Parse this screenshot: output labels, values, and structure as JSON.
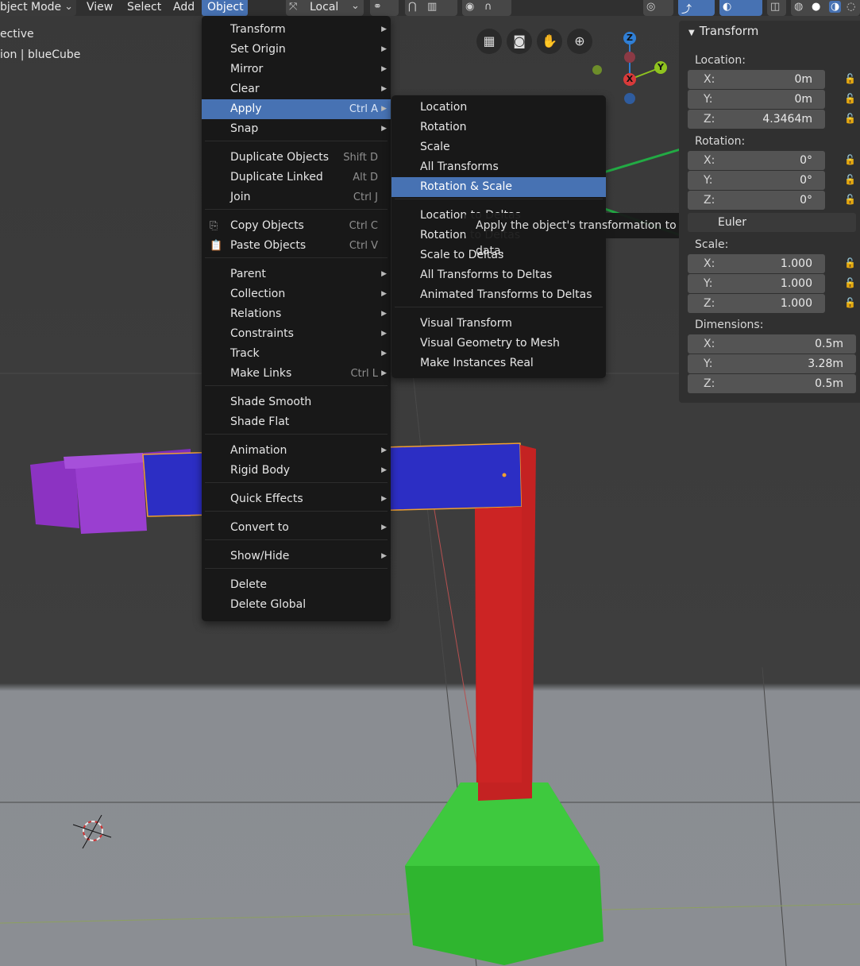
{
  "header": {
    "mode_label": "bject Mode",
    "view_label": "View",
    "select_label": "Select",
    "add_label": "Add",
    "object_label": "Object",
    "orientation_label": "Local"
  },
  "viewport": {
    "view_name": "ective",
    "object_info": "ion | blueCube",
    "gizmo": {
      "z": "Z",
      "y": "Y",
      "x": "X"
    }
  },
  "object_menu": {
    "items": [
      {
        "label": "Transform",
        "shortcut": "",
        "submenu": true
      },
      {
        "label": "Set Origin",
        "shortcut": "",
        "submenu": true
      },
      {
        "label": "Mirror",
        "shortcut": "",
        "submenu": true
      },
      {
        "label": "Clear",
        "shortcut": "",
        "submenu": true
      },
      {
        "label": "Apply",
        "shortcut": "Ctrl A",
        "submenu": true
      },
      {
        "label": "Snap",
        "shortcut": "",
        "submenu": true
      },
      {
        "label": "Duplicate Objects",
        "shortcut": "Shift D",
        "submenu": false
      },
      {
        "label": "Duplicate Linked",
        "shortcut": "Alt D",
        "submenu": false
      },
      {
        "label": "Join",
        "shortcut": "Ctrl J",
        "submenu": false
      },
      {
        "label": "Copy Objects",
        "shortcut": "Ctrl C",
        "submenu": false
      },
      {
        "label": "Paste Objects",
        "shortcut": "Ctrl V",
        "submenu": false
      },
      {
        "label": "Parent",
        "shortcut": "",
        "submenu": true
      },
      {
        "label": "Collection",
        "shortcut": "",
        "submenu": true
      },
      {
        "label": "Relations",
        "shortcut": "",
        "submenu": true
      },
      {
        "label": "Constraints",
        "shortcut": "",
        "submenu": true
      },
      {
        "label": "Track",
        "shortcut": "",
        "submenu": true
      },
      {
        "label": "Make Links",
        "shortcut": "Ctrl L",
        "submenu": true
      },
      {
        "label": "Shade Smooth",
        "shortcut": "",
        "submenu": false
      },
      {
        "label": "Shade Flat",
        "shortcut": "",
        "submenu": false
      },
      {
        "label": "Animation",
        "shortcut": "",
        "submenu": true
      },
      {
        "label": "Rigid Body",
        "shortcut": "",
        "submenu": true
      },
      {
        "label": "Quick Effects",
        "shortcut": "",
        "submenu": true
      },
      {
        "label": "Convert to",
        "shortcut": "",
        "submenu": true
      },
      {
        "label": "Show/Hide",
        "shortcut": "",
        "submenu": true
      },
      {
        "label": "Delete",
        "shortcut": "",
        "submenu": false
      },
      {
        "label": "Delete Global",
        "shortcut": "",
        "submenu": false
      }
    ]
  },
  "apply_menu": {
    "items": [
      {
        "label": "Location"
      },
      {
        "label": "Rotation"
      },
      {
        "label": "Scale"
      },
      {
        "label": "All Transforms"
      },
      {
        "label": "Rotation & Scale"
      },
      {
        "label": "Location to Deltas"
      },
      {
        "label": "Rotation to Deltas"
      },
      {
        "label": "Scale to Deltas"
      },
      {
        "label": "All Transforms to Deltas"
      },
      {
        "label": "Animated Transforms to Deltas"
      },
      {
        "label": "Visual Transform"
      },
      {
        "label": "Visual Geometry to Mesh"
      },
      {
        "label": "Make Instances Real"
      }
    ]
  },
  "tooltip": "Apply the object's transformation to its data.",
  "transform_panel": {
    "title": "Transform",
    "location_label": "Location:",
    "location": [
      {
        "k": "X:",
        "v": "0m"
      },
      {
        "k": "Y:",
        "v": "0m"
      },
      {
        "k": "Z:",
        "v": "4.3464m"
      }
    ],
    "rotation_label": "Rotation:",
    "rotation": [
      {
        "k": "X:",
        "v": "0°"
      },
      {
        "k": "Y:",
        "v": "0°"
      },
      {
        "k": "Z:",
        "v": "0°"
      }
    ],
    "rotation_mode": "Euler",
    "scale_label": "Scale:",
    "scale": [
      {
        "k": "X:",
        "v": "1.000"
      },
      {
        "k": "Y:",
        "v": "1.000"
      },
      {
        "k": "Z:",
        "v": "1.000"
      }
    ],
    "dimensions_label": "Dimensions:",
    "dimensions": [
      {
        "k": "X:",
        "v": "0.5m"
      },
      {
        "k": "Y:",
        "v": "3.28m"
      },
      {
        "k": "Z:",
        "v": "0.5m"
      }
    ]
  },
  "colors": {
    "accent": "#4772b3",
    "menu_bg": "#181818",
    "blue_cube": "#2c2ec4",
    "red_pole": "#c42222",
    "green_base": "#33c233",
    "purple_cubes": "#9a3fd0",
    "annotation": "#22aa44"
  }
}
